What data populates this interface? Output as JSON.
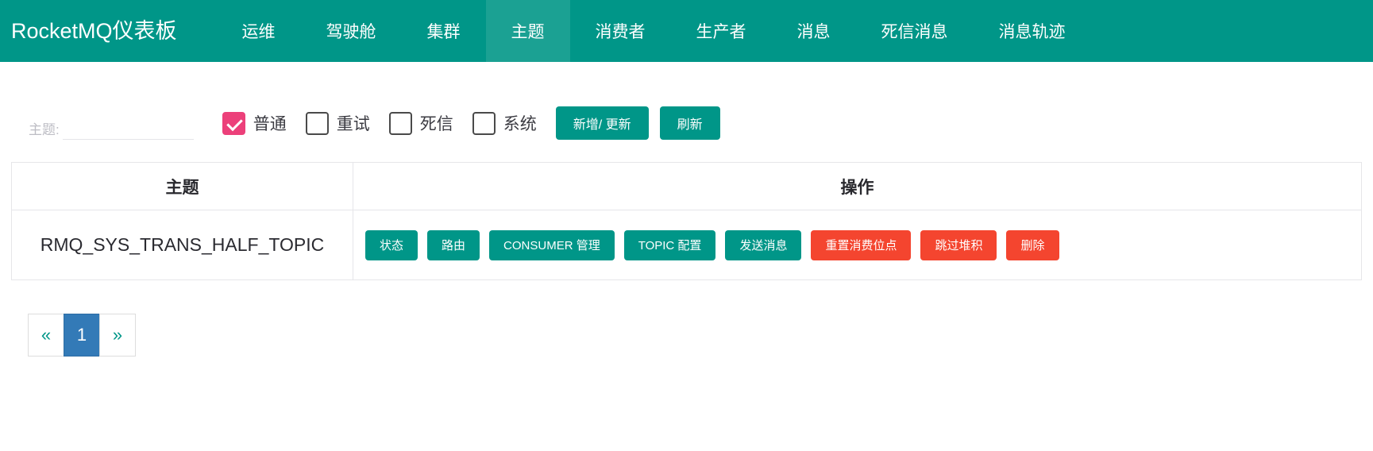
{
  "navbar": {
    "brand": "RocketMQ仪表板",
    "items": [
      {
        "label": "运维",
        "active": false
      },
      {
        "label": "驾驶舱",
        "active": false
      },
      {
        "label": "集群",
        "active": false
      },
      {
        "label": "主题",
        "active": true
      },
      {
        "label": "消费者",
        "active": false
      },
      {
        "label": "生产者",
        "active": false
      },
      {
        "label": "消息",
        "active": false
      },
      {
        "label": "死信消息",
        "active": false
      },
      {
        "label": "消息轨迹",
        "active": false
      }
    ],
    "accent_color": "#009688",
    "active_color": "#1ba193"
  },
  "filter": {
    "topic_label": "主题:",
    "topic_value": "",
    "topic_placeholder": "",
    "checkboxes": [
      {
        "label": "普通",
        "checked": true
      },
      {
        "label": "重试",
        "checked": false
      },
      {
        "label": "死信",
        "checked": false
      },
      {
        "label": "系统",
        "checked": false
      }
    ],
    "checked_color": "#ec407a",
    "add_update_label": "新增/ 更新",
    "refresh_label": "刷新"
  },
  "table": {
    "headers": [
      "主题",
      "操作"
    ],
    "rows": [
      {
        "topic": "RMQ_SYS_TRANS_HALF_TOPIC",
        "actions": [
          {
            "label": "状态",
            "style": "teal"
          },
          {
            "label": "路由",
            "style": "teal"
          },
          {
            "label": "CONSUMER 管理",
            "style": "teal"
          },
          {
            "label": "TOPIC 配置",
            "style": "teal"
          },
          {
            "label": "发送消息",
            "style": "teal"
          },
          {
            "label": "重置消费位点",
            "style": "red"
          },
          {
            "label": "跳过堆积",
            "style": "red"
          },
          {
            "label": "删除",
            "style": "red"
          }
        ]
      }
    ],
    "teal_color": "#009688",
    "red_color": "#f4452f"
  },
  "pagination": {
    "prev": "«",
    "next": "»",
    "pages": [
      "1"
    ],
    "current": "1",
    "active_color": "#337ab7"
  }
}
